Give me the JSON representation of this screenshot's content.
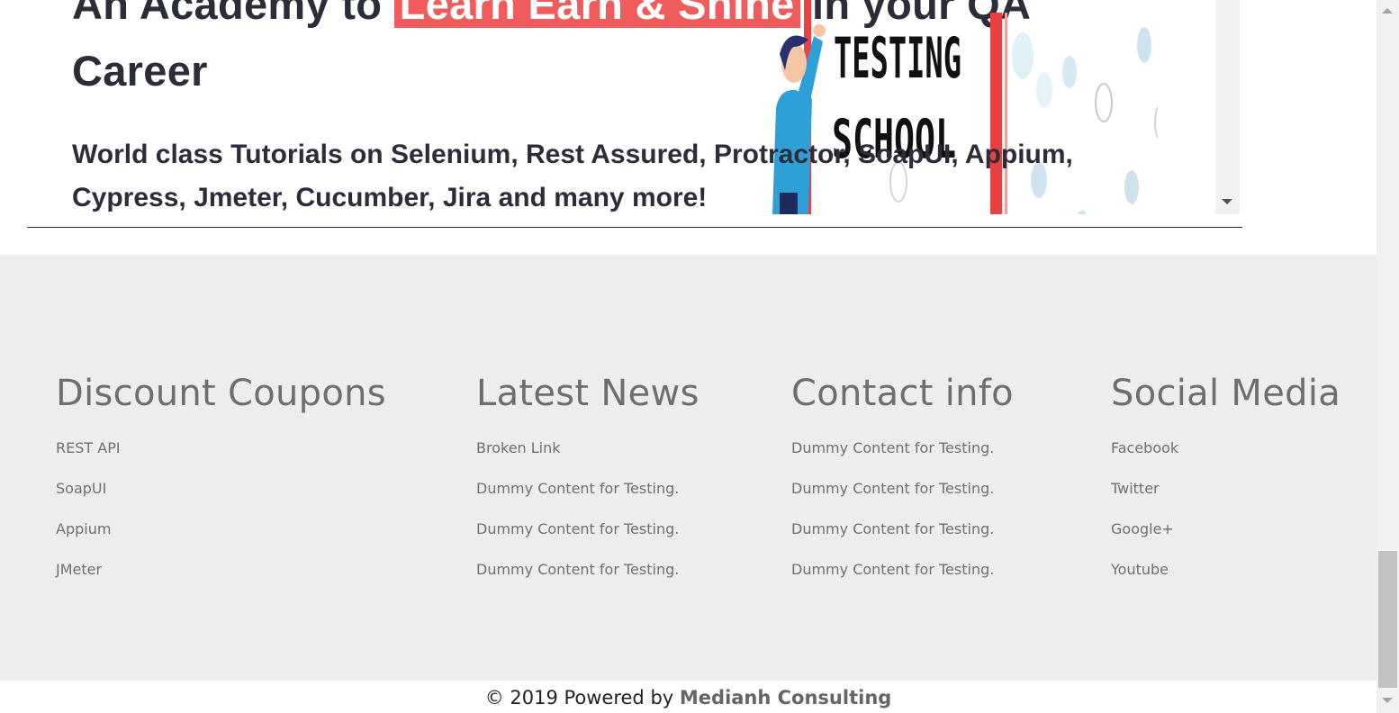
{
  "hero": {
    "title_before": "An Academy to",
    "title_highlight": "Learn Earn & Shine",
    "title_after": "in your QA Career",
    "subtitle": "World class Tutorials on Selenium, Rest Assured, Protractor, SoapUI, Appium, Cypress, Jmeter, Cucumber, Jira and many more!",
    "image_text_line1": "TESTING",
    "image_text_line2": "SCHOOL"
  },
  "footer": {
    "columns": [
      {
        "heading": "Discount Coupons",
        "links": [
          "REST API",
          "SoapUI",
          "Appium",
          "JMeter"
        ]
      },
      {
        "heading": "Latest News",
        "links": [
          "Broken Link",
          "Dummy Content for Testing.",
          "Dummy Content for Testing.",
          "Dummy Content for Testing."
        ]
      },
      {
        "heading": "Contact info",
        "links": [
          "Dummy Content for Testing.",
          "Dummy Content for Testing.",
          "Dummy Content for Testing.",
          "Dummy Content for Testing."
        ]
      },
      {
        "heading": "Social Media",
        "links": [
          "Facebook",
          "Twitter",
          "Google+",
          "Youtube"
        ]
      }
    ]
  },
  "copyright": {
    "text": "© 2019 Powered by",
    "brand": "Medianh Consulting"
  },
  "colors": {
    "highlight": "#f05b5b",
    "footer_bg": "#ededed",
    "heading_text": "#2b2d38"
  }
}
